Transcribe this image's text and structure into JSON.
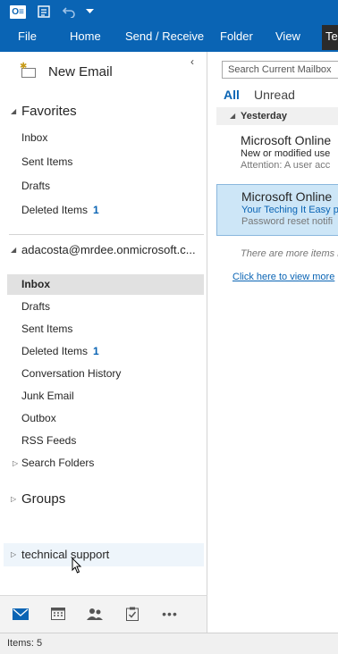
{
  "titlebar": {
    "logo_text": "O≡",
    "icons": [
      "outlook-logo-icon",
      "send-receive-icon",
      "undo-icon",
      "qat-dropdown-icon"
    ]
  },
  "ribbon": {
    "tabs": [
      {
        "label": "File"
      },
      {
        "label": "Home"
      },
      {
        "label": "Send / Receive"
      },
      {
        "label": "Folder"
      },
      {
        "label": "View"
      },
      {
        "label": "Te"
      }
    ]
  },
  "folder_pane": {
    "new_email_label": "New Email",
    "favorites": {
      "header": "Favorites",
      "items": [
        {
          "label": "Inbox",
          "count": ""
        },
        {
          "label": "Sent Items",
          "count": ""
        },
        {
          "label": "Drafts",
          "count": ""
        },
        {
          "label": "Deleted Items",
          "count": "1"
        }
      ]
    },
    "account": {
      "header": "adacosta@mrdee.onmicrosoft.c...",
      "items": [
        {
          "label": "Inbox",
          "count": "",
          "selected": true
        },
        {
          "label": "Drafts",
          "count": ""
        },
        {
          "label": "Sent Items",
          "count": ""
        },
        {
          "label": "Deleted Items",
          "count": "1"
        },
        {
          "label": "Conversation History",
          "count": ""
        },
        {
          "label": "Junk Email",
          "count": ""
        },
        {
          "label": "Outbox",
          "count": ""
        },
        {
          "label": "RSS Feeds",
          "count": ""
        },
        {
          "label": "Search Folders",
          "count": ""
        }
      ]
    },
    "groups_header": "Groups",
    "shared_mailbox": "technical support"
  },
  "navbar": {
    "items": [
      "mail-icon",
      "calendar-icon",
      "people-icon",
      "tasks-icon",
      "more-icon"
    ],
    "more_label": "•••"
  },
  "message_list": {
    "search_placeholder": "Search Current Mailbox",
    "filter_all": "All",
    "filter_unread": "Unread",
    "group_header": "Yesterday",
    "messages": [
      {
        "sender": "Microsoft Online",
        "subject": "New or modified use",
        "preview": "Attention: A user acc"
      },
      {
        "sender": "Microsoft Online",
        "subject": "Your Teching It Easy p",
        "preview": "Password reset notifi"
      }
    ],
    "more_items_text": "There are more items in",
    "view_more_link": "Click here to view more"
  },
  "statusbar": {
    "items_text": "Items: 5"
  },
  "colors": {
    "accent": "#0a64b4",
    "selected_bg": "#e1e1e1",
    "selected_message_bg": "#cde6f7"
  }
}
